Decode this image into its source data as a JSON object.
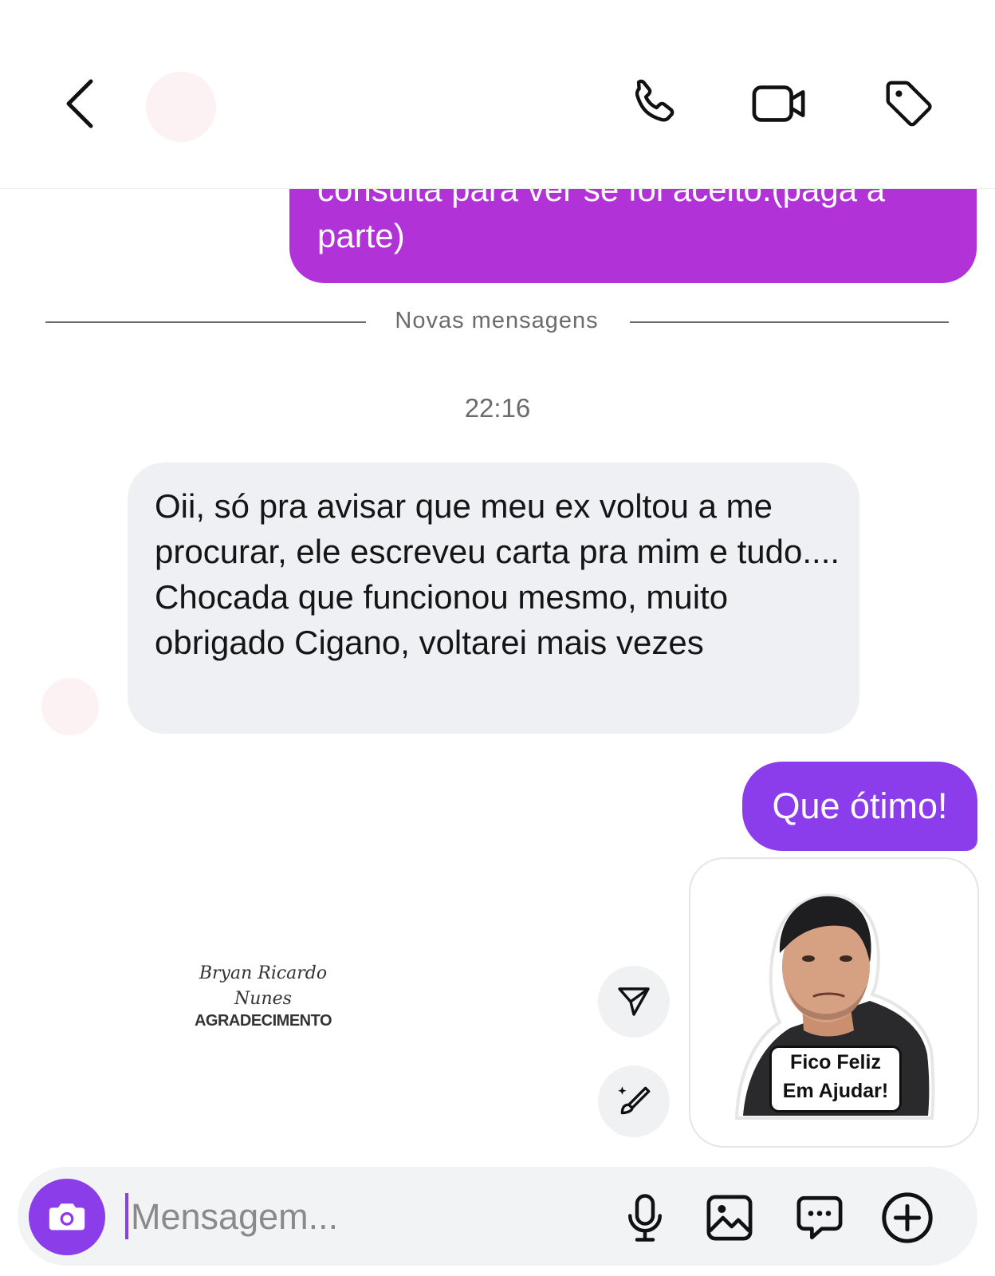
{
  "header": {
    "back_icon": "chevron-left-icon",
    "call_icon": "phone-icon",
    "video_icon": "video-camera-icon",
    "tag_icon": "tag-icon"
  },
  "chat": {
    "prev_outgoing_lines": [
      "consulta para ver se foi aceito.(paga a",
      "parte)"
    ],
    "divider_label": "Novas mensagens",
    "timestamp": "22:16",
    "incoming_message": "Oii, só pra avisar que meu ex voltou a me procurar, ele escreveu carta pra mim e tudo.... Chocada que funcionou mesmo, muito obrigado Cigano, voltarei mais vezes",
    "outgoing_reply": "Que ótimo!",
    "sticker": {
      "caption_line1": "Fico Feliz",
      "caption_line2": "Em Ajudar!"
    },
    "watermark": {
      "name_line1": "Bryan Ricardo",
      "name_line2": "Nunes",
      "title": "AGRADECIMENTO"
    },
    "actions": {
      "share_icon": "send-icon",
      "edit_icon": "magic-brush-icon"
    },
    "colors": {
      "outgoing_bubble": "#b132d6",
      "reply_bubble": "#8c3deb",
      "incoming_bubble": "#eff0f3"
    }
  },
  "composer": {
    "placeholder": "Mensagem...",
    "camera_icon": "camera-icon",
    "mic_icon": "microphone-icon",
    "gallery_icon": "image-icon",
    "sticker_icon": "chat-bubble-icon",
    "plus_icon": "plus-circle-icon"
  }
}
